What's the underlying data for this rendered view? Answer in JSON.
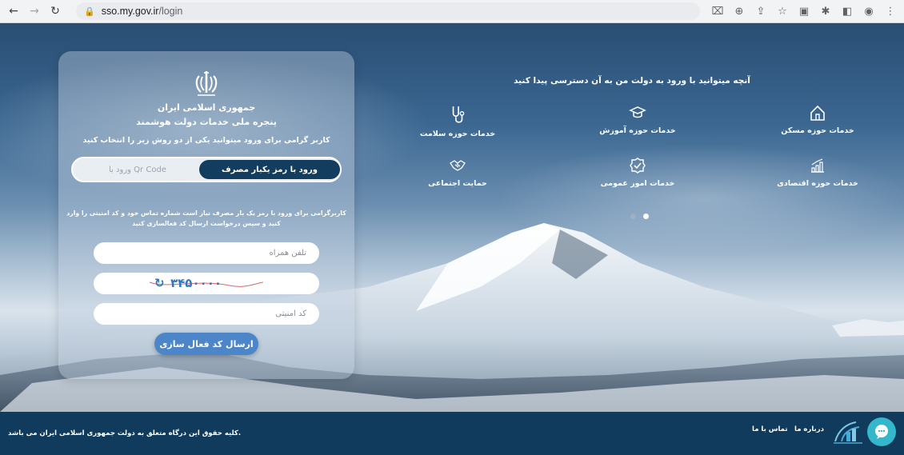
{
  "browser": {
    "url_host": "sso.my.gov.ir",
    "url_path": "/login",
    "back_icon": "arrow-left-icon",
    "forward_icon": "arrow-right-icon",
    "reload_icon": "reload-icon"
  },
  "login": {
    "org_name": "جمهوری اسلامی ایران",
    "portal_name": "پنجره ملی خدمات دولت هوشمند",
    "prompt": "کاربر گرامی برای ورود میتوانید یکی از دو روش زیر را انتخاب کنید",
    "tab_otp": "ورود با رمز یکبار مصرف",
    "tab_qr": "ورود با Qr Code",
    "instructions": "کاربرگرامی برای ورود با رمز یک بار مصرف نیاز است شماره تماس خود و کد امنیتی را وارد کنید و سپس درخواست ارسال کد فعالسازی کنید",
    "phone_placeholder": "تلفن همراه",
    "captcha_text": "۳۴۵۰۰۰۰",
    "security_placeholder": "کد امنیتی",
    "submit_label": "ارسال کد فعال سازی"
  },
  "services": {
    "heading": "آنچه میتوانید با ورود به دولت من به آن دسترسی پیدا کنید",
    "items": [
      {
        "label": "خدمات حوزه مسکن",
        "icon": "house-icon"
      },
      {
        "label": "خدمات حوزه آموزش",
        "icon": "graduation-cap-icon"
      },
      {
        "label": "خدمات حوزه سلامت",
        "icon": "stethoscope-icon"
      },
      {
        "label": "خدمات حوزه اقتصادی",
        "icon": "growth-chart-icon"
      },
      {
        "label": "خدمات امور عمومی",
        "icon": "check-badge-icon"
      },
      {
        "label": "حمایت اجتماعی",
        "icon": "handshake-icon"
      }
    ],
    "carousel": {
      "active_index": 1,
      "count": 2,
      "active_color": "#ffffff",
      "inactive_color": "#9fb0c2"
    }
  },
  "footer": {
    "copyright": "کلیه حقوق این درگاه متعلق به دولت جمهوری اسلامی ایران می باشد.",
    "about": "درباره ما",
    "contact": "تماس با ما",
    "logo_icon": "dolat-man-logo-icon",
    "chat_icon": "chat-bubble-icon"
  },
  "colors": {
    "primary_dark": "#123d5f",
    "button_blue": "#4c86c8",
    "footer_bg": "#113b5c",
    "chat_teal": "#34b7cb"
  }
}
